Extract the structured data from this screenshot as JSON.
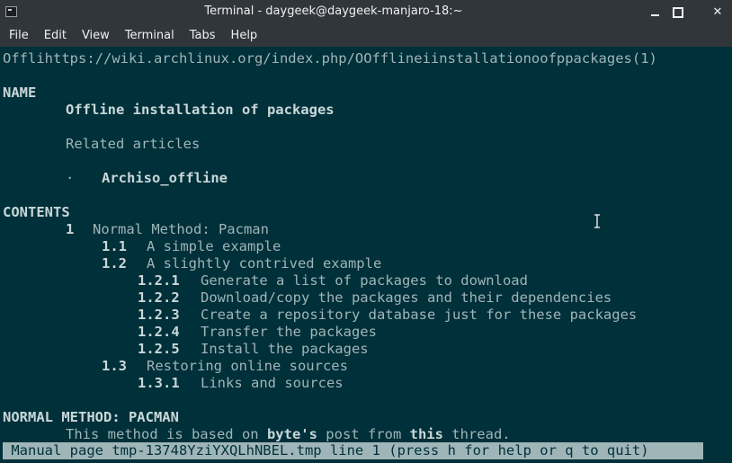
{
  "window": {
    "title": "Terminal - daygeek@daygeek-manjaro-18:~",
    "minimize_glyph": "minimize-icon",
    "maximize_glyph": "maximize-icon",
    "close_glyph": "✕"
  },
  "menu": [
    "File",
    "Edit",
    "View",
    "Terminal",
    "Tabs",
    "Help"
  ],
  "terminal": {
    "header_line": "Offlihttps://wiki.archlinux.org/index.php/OOfflineiinstallationoofppackages(1)",
    "name_heading": "NAME",
    "name_title": "Offline installation of packages",
    "related_label": "Related articles",
    "bullet": "·",
    "related_item": "Archiso_offline",
    "contents_heading": "CONTENTS",
    "toc": [
      {
        "num": "1",
        "text": "Normal Method: Pacman"
      },
      {
        "num": "1.1",
        "text": "A simple example"
      },
      {
        "num": "1.2",
        "text": "A slightly contrived example"
      },
      {
        "num": "1.2.1",
        "text": "Generate a list of packages to download"
      },
      {
        "num": "1.2.2",
        "text": "Download/copy the packages and their dependencies"
      },
      {
        "num": "1.2.3",
        "text": "Create a repository database just for these packages"
      },
      {
        "num": "1.2.4",
        "text": "Transfer the packages"
      },
      {
        "num": "1.2.5",
        "text": "Install the packages"
      },
      {
        "num": "1.3",
        "text": "Restoring online sources"
      },
      {
        "num": "1.3.1",
        "text": "Links and sources"
      }
    ],
    "section_heading": "NORMAL METHOD: PACMAN",
    "body_pre": "This method is based on ",
    "body_b1": "byte's",
    "body_mid": " post from ",
    "body_b2": "this",
    "body_post": " thread.",
    "status_line": " Manual page tmp-13748YziYXQLhNBEL.tmp line 1 (press h for help or q to quit)"
  }
}
